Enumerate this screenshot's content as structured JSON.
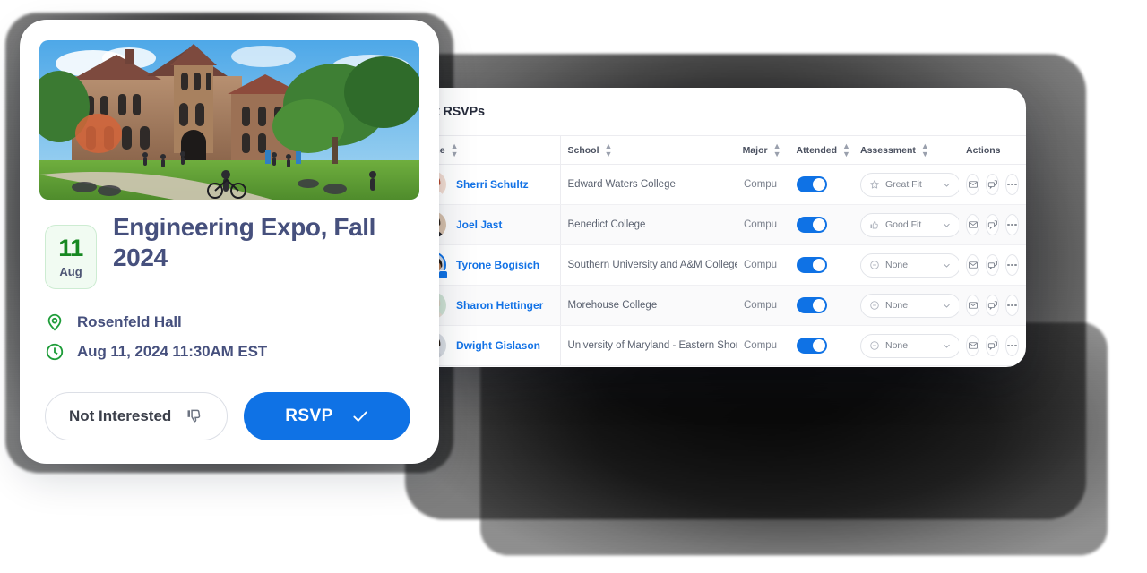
{
  "event_card": {
    "photo_alt": "campus-building-lawn-photo",
    "date_badge": {
      "day": "11",
      "month": "Aug"
    },
    "title": "Engineering Expo, Fall 2024",
    "meta": [
      {
        "icon": "location-pin-icon",
        "text": "Rosenfeld Hall"
      },
      {
        "icon": "clock-icon",
        "text": "Aug 11, 2024 11:30AM EST"
      }
    ],
    "buttons": {
      "not_interested": {
        "label": "Not Interested",
        "icon": "thumbs-down-icon"
      },
      "rsvp": {
        "label": "RSVP",
        "icon": "check-icon"
      }
    }
  },
  "rsvp_panel": {
    "title": "Event RSVPs",
    "columns": [
      {
        "key": "select",
        "label": ""
      },
      {
        "key": "name",
        "label": "Name",
        "sortable": true
      },
      {
        "key": "school",
        "label": "School",
        "sortable": true
      },
      {
        "key": "major",
        "label": "Major",
        "sortable": true
      },
      {
        "key": "attended",
        "label": "Attended",
        "sortable": true
      },
      {
        "key": "assessment",
        "label": "Assessment",
        "sortable": true
      },
      {
        "key": "actions",
        "label": "Actions",
        "sortable": false
      }
    ],
    "rows": [
      {
        "name": "Sherri Schultz",
        "school": "Edward Waters College",
        "major": "Compu",
        "attended": true,
        "assessment": {
          "label": "Great Fit",
          "icon": "star-icon"
        },
        "avatar": "avatar-sherri",
        "avatar_ring": false
      },
      {
        "name": "Joel Jast",
        "school": "Benedict College",
        "major": "Compu",
        "attended": true,
        "assessment": {
          "label": "Good Fit",
          "icon": "thumbs-up-icon"
        },
        "avatar": "avatar-joel",
        "avatar_ring": false
      },
      {
        "name": "Tyrone Bogisich",
        "school": "Southern University and A&M College",
        "major": "Compu",
        "attended": true,
        "assessment": {
          "label": "None",
          "icon": "minus-circle-icon"
        },
        "avatar": "avatar-tyrone",
        "avatar_ring": true
      },
      {
        "name": "Sharon Hettinger",
        "school": "Morehouse College",
        "major": "Compu",
        "attended": true,
        "assessment": {
          "label": "None",
          "icon": "minus-circle-icon"
        },
        "avatar": "avatar-sharon",
        "avatar_ring": false
      },
      {
        "name": "Dwight Gislason",
        "school": "University of Maryland - Eastern Shore",
        "major": "Compu",
        "attended": true,
        "assessment": {
          "label": "None",
          "icon": "minus-circle-icon"
        },
        "avatar": "avatar-dwight",
        "avatar_ring": false
      }
    ],
    "row_actions": [
      {
        "name": "email-action",
        "icon": "envelope-icon"
      },
      {
        "name": "message-action",
        "icon": "chat-bubbles-icon"
      },
      {
        "name": "more-action",
        "icon": "ellipsis-icon"
      }
    ]
  },
  "colors": {
    "accent_blue": "#0f72e5",
    "link_blue": "#1272e6",
    "title_navy": "#46507d",
    "badge_green": "#168821",
    "badge_green_bg": "#f1fbf2",
    "icon_green": "#1f9d3a"
  }
}
